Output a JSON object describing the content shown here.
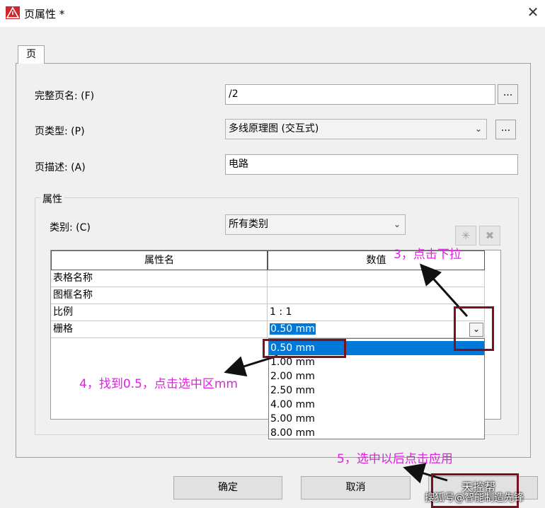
{
  "window": {
    "title": "页属性 *",
    "close_glyph": "✕"
  },
  "tabs": [
    {
      "label": "页"
    }
  ],
  "form": {
    "full_name_label": "完整页名: (F)",
    "full_name_value": "/2",
    "page_type_label": "页类型: (P)",
    "page_type_value": "多线原理图 (交互式)",
    "page_desc_label": "页描述: (A)",
    "page_desc_value": "电路",
    "dots": "..."
  },
  "properties": {
    "group_label": "属性",
    "category_label": "类别: (C)",
    "category_value": "所有类别",
    "columns": [
      "属性名",
      "数值"
    ],
    "rows": [
      {
        "name": "表格名称",
        "value": ""
      },
      {
        "name": "图框名称",
        "value": ""
      },
      {
        "name": "比例",
        "value": "1 : 1"
      },
      {
        "name": "栅格",
        "value": "0.50 mm"
      }
    ],
    "grid_options": [
      "0.50 mm",
      "1.00 mm",
      "2.00 mm",
      "2.50 mm",
      "4.00 mm",
      "5.00 mm",
      "8.00 mm"
    ]
  },
  "buttons": {
    "ok": "确定",
    "cancel": "取消"
  },
  "annotations": {
    "step3": "3，点击下拉",
    "step4": "4，找到0.5，点击选中区mm",
    "step5": "5，选中以后点击应用"
  },
  "watermark": {
    "line1": "天控帮",
    "line2": "搜狐号@智能制造先锋"
  },
  "colors": {
    "selection": "#0078d7",
    "annotation_text": "#e020e0",
    "annotation_box": "#7a1020"
  },
  "icons": [
    "app-warning-icon",
    "close-icon",
    "chevron-down-icon",
    "new-property-icon",
    "delete-property-icon"
  ]
}
